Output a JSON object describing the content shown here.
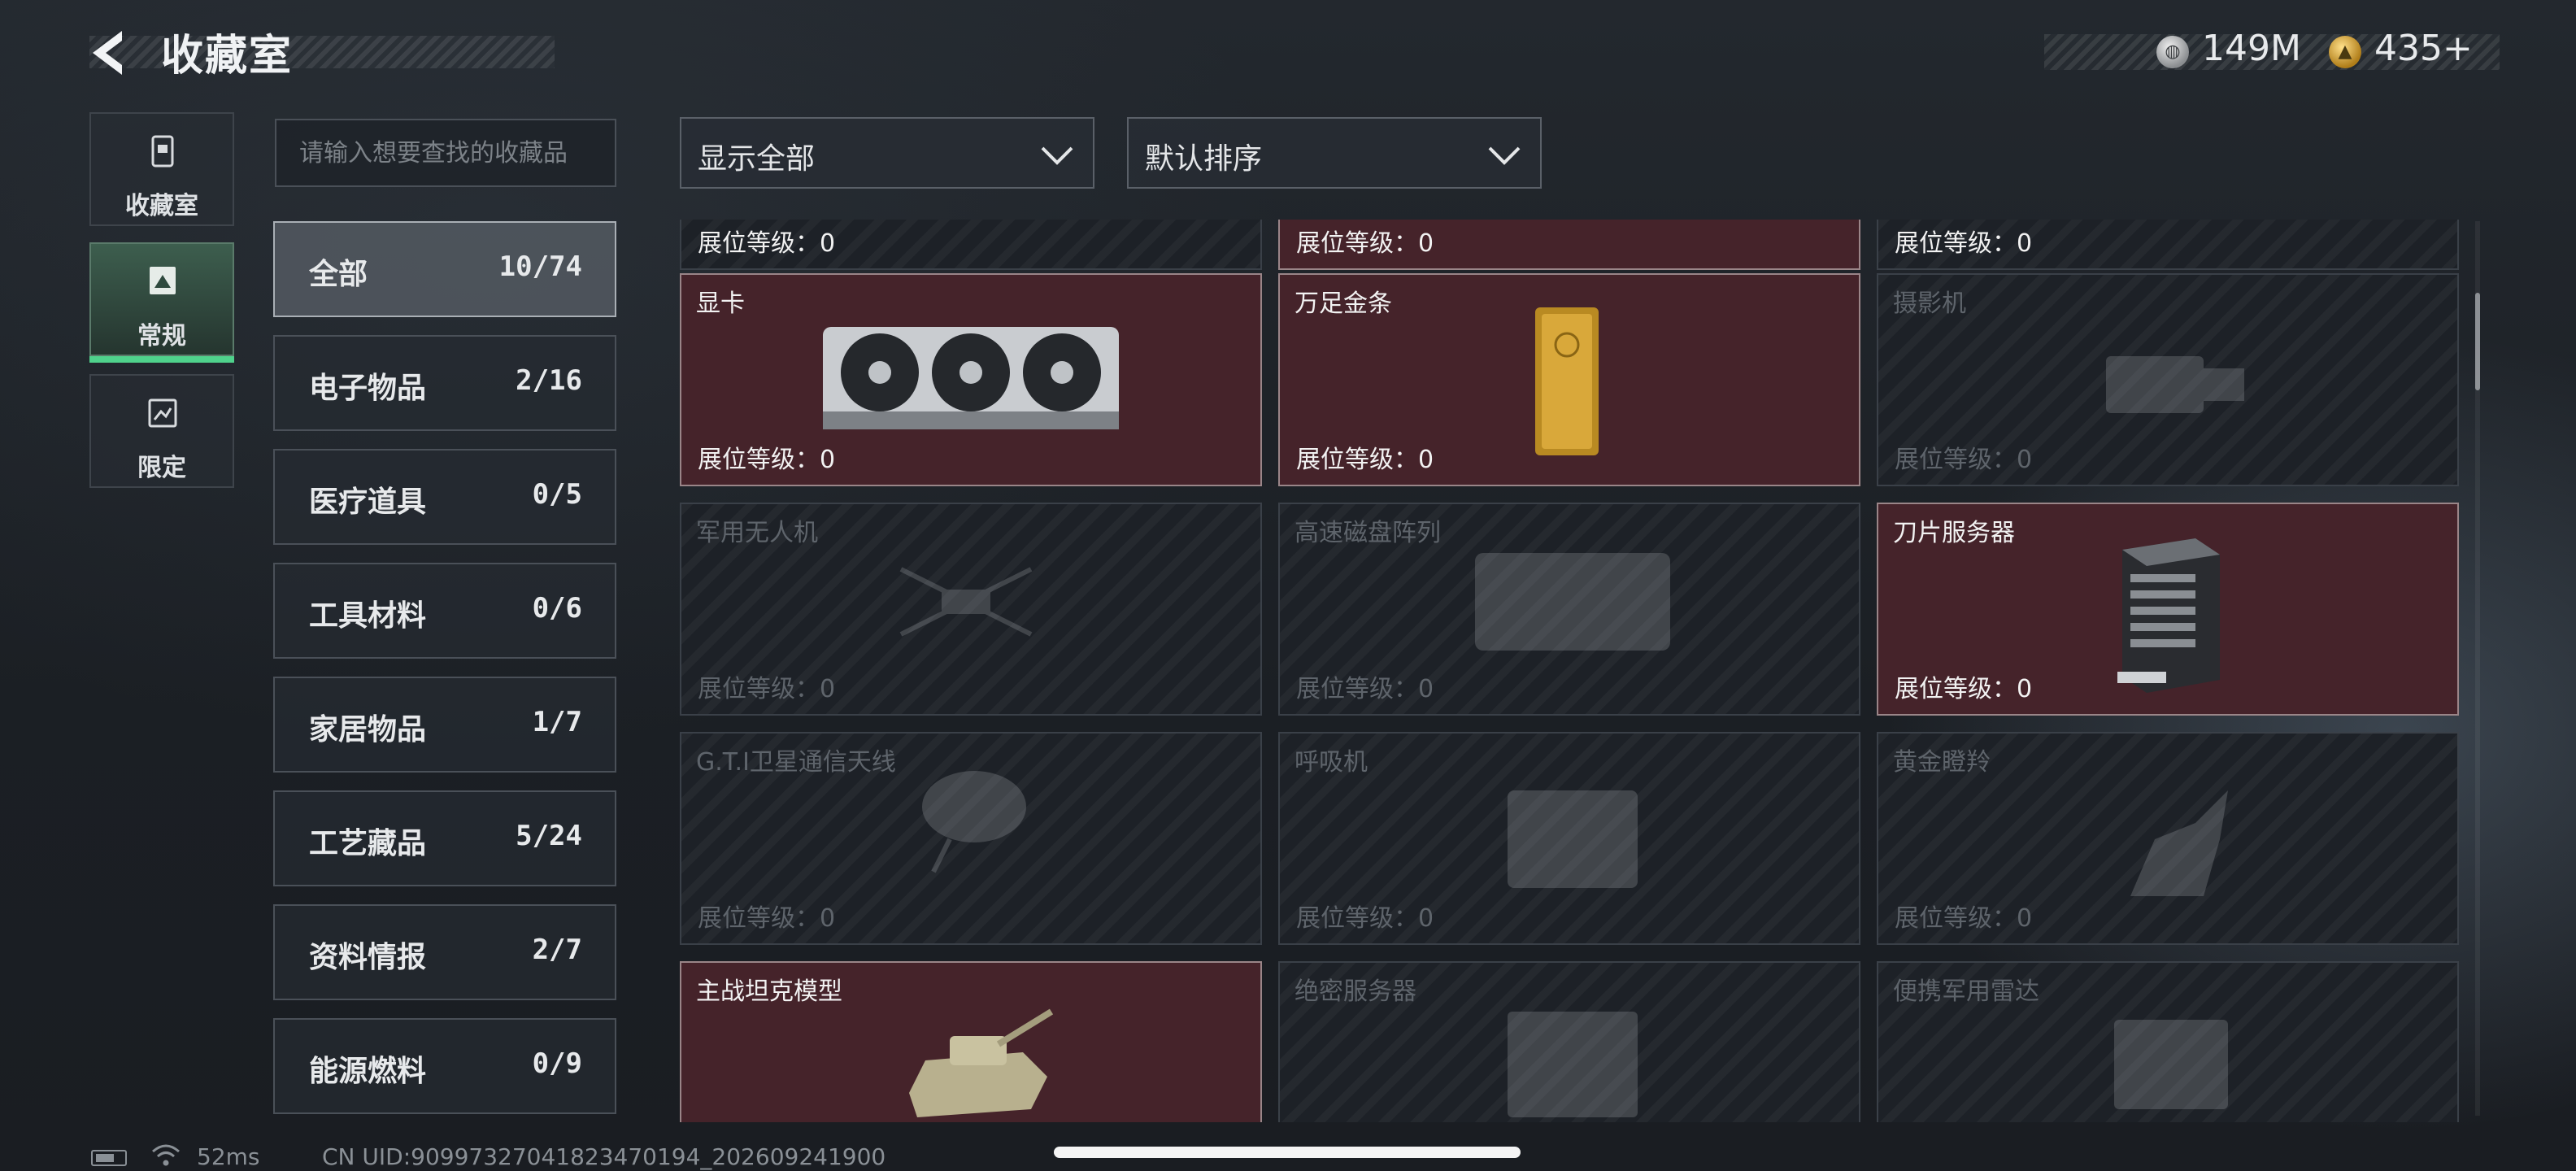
{
  "header": {
    "title": "收藏室",
    "currency": {
      "silver": "149M",
      "gold": "435+"
    }
  },
  "nav": [
    {
      "label": "收藏室",
      "icon": "display-case-icon",
      "active": false
    },
    {
      "label": "常规",
      "icon": "picture-frame-icon",
      "active": true
    },
    {
      "label": "限定",
      "icon": "limited-icon",
      "active": false
    }
  ],
  "search": {
    "placeholder": "请输入想要查找的收藏品"
  },
  "filters": {
    "show": "显示全部",
    "sort": "默认排序"
  },
  "categories": [
    {
      "name": "全部",
      "count": "10/74",
      "active": true
    },
    {
      "name": "电子物品",
      "count": "2/16"
    },
    {
      "name": "医疗道具",
      "count": "0/5"
    },
    {
      "name": "工具材料",
      "count": "0/6"
    },
    {
      "name": "家居物品",
      "count": "1/7"
    },
    {
      "name": "工艺藏品",
      "count": "5/24"
    },
    {
      "name": "资料情报",
      "count": "2/7"
    },
    {
      "name": "能源燃料",
      "count": "0/9"
    }
  ],
  "level_label": "展位等级：0",
  "items": [
    {
      "name": "",
      "level": "展位等级：0",
      "owned": false
    },
    {
      "name": "",
      "level": "展位等级：0",
      "owned": true
    },
    {
      "name": "",
      "level": "展位等级：0",
      "owned": false
    },
    {
      "name": "显卡",
      "level": "展位等级：0",
      "owned": true,
      "icon": "graphics-card-icon"
    },
    {
      "name": "万足金条",
      "level": "展位等级：0",
      "owned": true,
      "icon": "gold-bar-icon"
    },
    {
      "name": "摄影机",
      "level": "展位等级：0",
      "owned": false,
      "icon": "camera-icon"
    },
    {
      "name": "军用无人机",
      "level": "展位等级：0",
      "owned": false,
      "icon": "drone-icon"
    },
    {
      "name": "高速磁盘阵列",
      "level": "展位等级：0",
      "owned": false,
      "icon": "disk-array-icon"
    },
    {
      "name": "刀片服务器",
      "level": "展位等级：0",
      "owned": true,
      "icon": "blade-server-icon"
    },
    {
      "name": "G.T.I卫星通信天线",
      "level": "展位等级：0",
      "owned": false,
      "icon": "satellite-dish-icon"
    },
    {
      "name": "呼吸机",
      "level": "展位等级：0",
      "owned": false,
      "icon": "ventilator-icon"
    },
    {
      "name": "黄金瞪羚",
      "level": "展位等级：0",
      "owned": false,
      "icon": "gazelle-statue-icon"
    },
    {
      "name": "主战坦克模型",
      "level": "",
      "owned": true,
      "icon": "tank-model-icon"
    },
    {
      "name": "绝密服务器",
      "level": "",
      "owned": false,
      "icon": "server-icon"
    },
    {
      "name": "便携军用雷达",
      "level": "",
      "owned": false,
      "icon": "radar-icon"
    }
  ],
  "status": {
    "ping": "52ms",
    "uid": "CN UID:90997327041823470194_202609241900"
  },
  "colors": {
    "accent": "#4fd28c",
    "owned_card": "#45232a",
    "card": "#1d2127"
  }
}
